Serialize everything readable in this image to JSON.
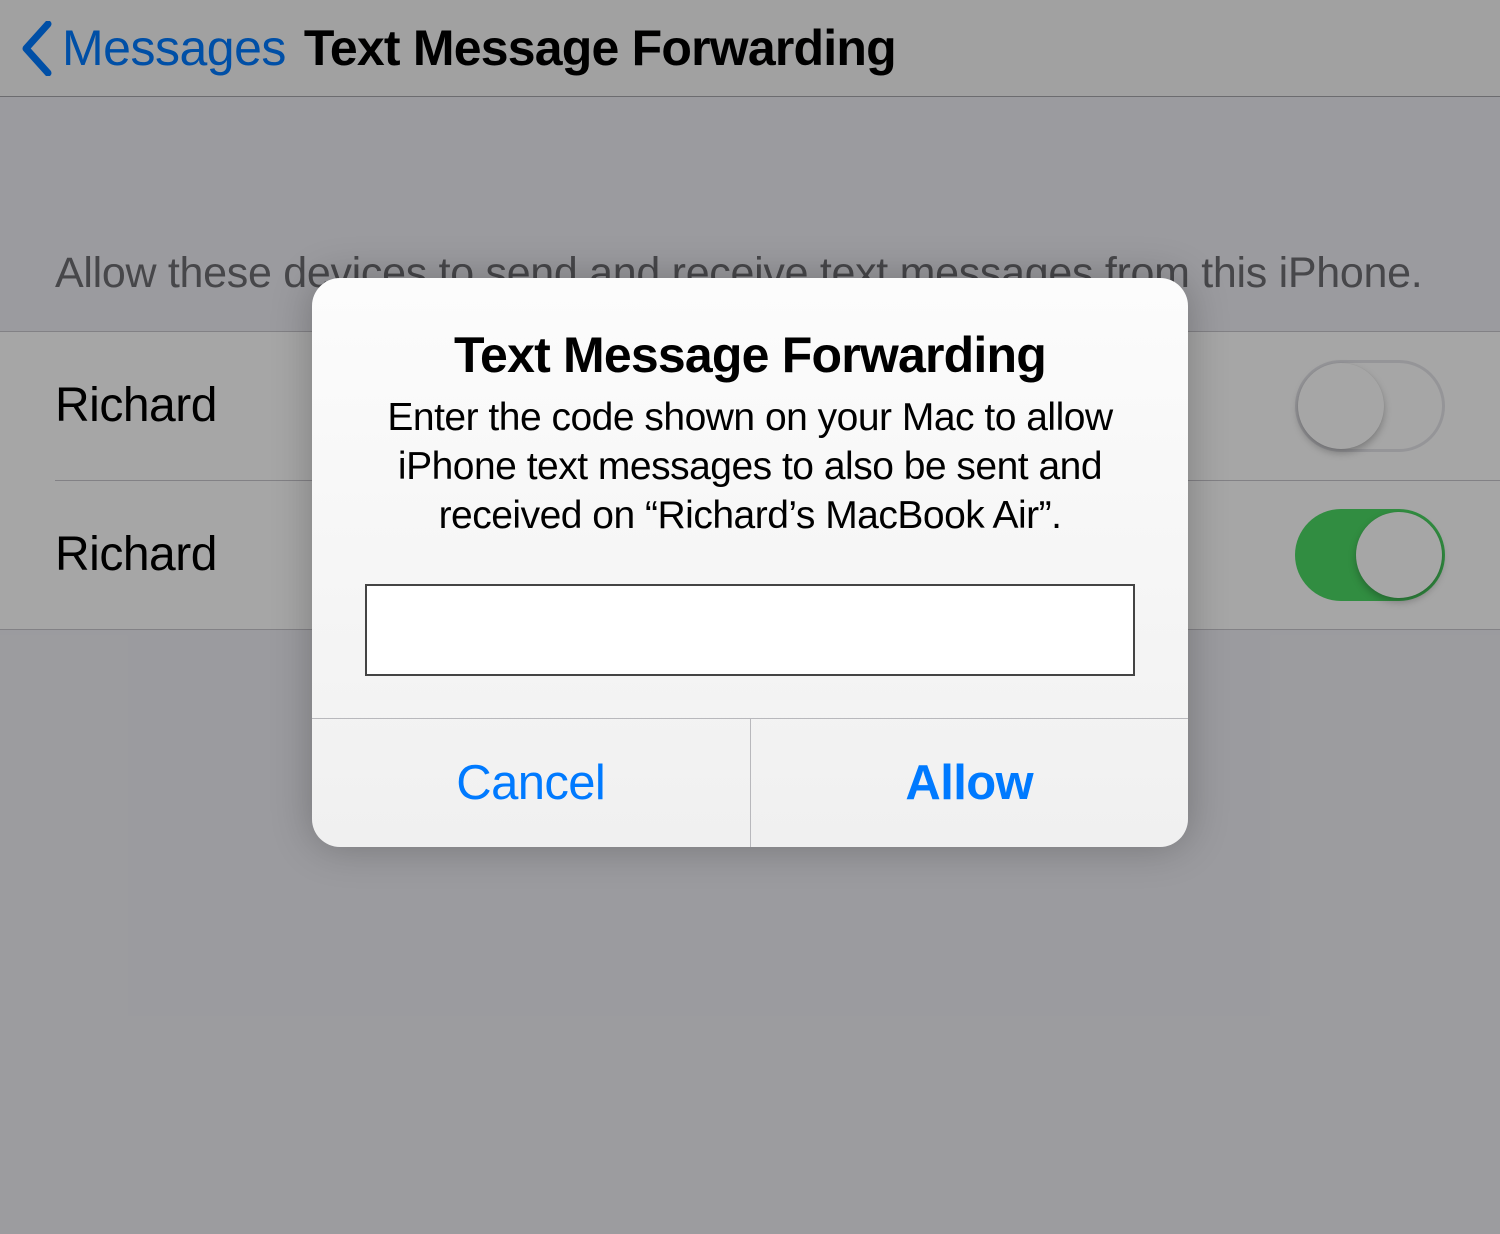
{
  "header": {
    "back_label": "Messages",
    "title": "Text Message Forwarding"
  },
  "section": {
    "description": "Allow these devices to send and receive text messages from this iPhone."
  },
  "devices": [
    {
      "name": "Richard",
      "enabled": false
    },
    {
      "name": "Richard",
      "enabled": true
    }
  ],
  "modal": {
    "title": "Text Message Forwarding",
    "message": "Enter the code shown on your Mac to allow iPhone text messages to also be sent and received on “Richard’s MacBook Air”.",
    "input_value": "",
    "cancel_label": "Cancel",
    "allow_label": "Allow"
  }
}
